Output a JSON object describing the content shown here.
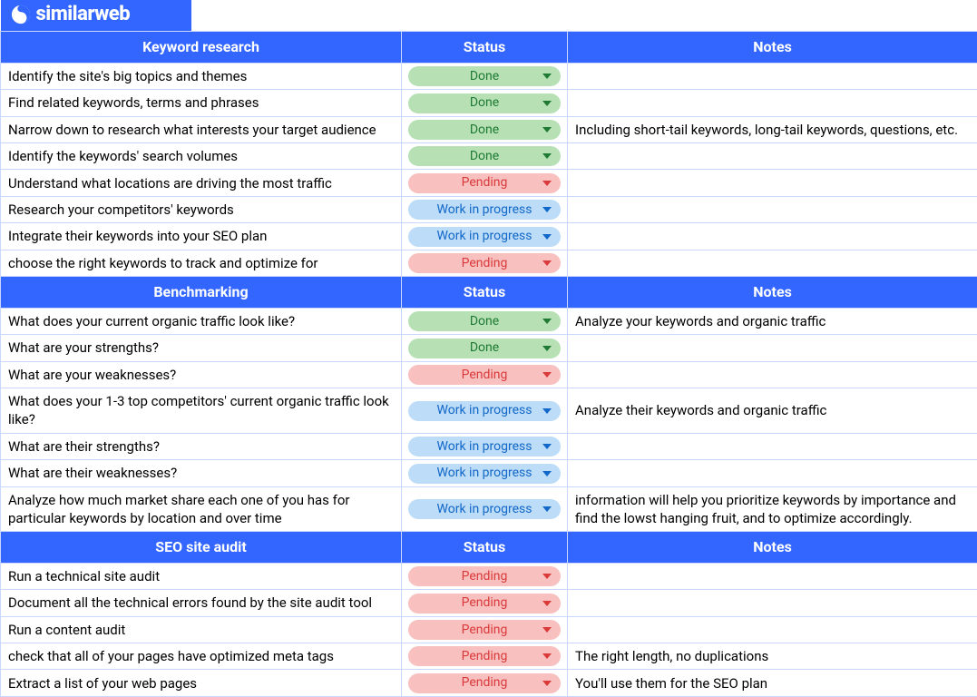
{
  "brand": "similarweb",
  "status_labels": {
    "done": "Done",
    "pending": "Pending",
    "wip": "Work in progress"
  },
  "sections": [
    {
      "title": "Keyword research",
      "status_header": "Status",
      "notes_header": "Notes",
      "rows": [
        {
          "task": "Identify the site's big topics and themes",
          "status": "done",
          "notes": ""
        },
        {
          "task": "Find related keywords, terms and phrases",
          "status": "done",
          "notes": ""
        },
        {
          "task": "Narrow down to research what interests your target audience",
          "status": "done",
          "notes": "Including short-tail keywords, long-tail keywords, questions, etc."
        },
        {
          "task": "Identify the keywords' search volumes",
          "status": "done",
          "notes": ""
        },
        {
          "task": "Understand what locations are driving the most traffic",
          "status": "pending",
          "notes": ""
        },
        {
          "task": "Research your competitors' keywords",
          "status": "wip",
          "notes": ""
        },
        {
          "task": "Integrate their keywords into your SEO plan",
          "status": "wip",
          "notes": ""
        },
        {
          "task": "choose the right keywords to track and optimize for",
          "status": "pending",
          "notes": ""
        }
      ]
    },
    {
      "title": "Benchmarking",
      "status_header": "Status",
      "notes_header": "Notes",
      "rows": [
        {
          "task": "What does your current organic traffic look like?",
          "status": "done",
          "notes": "Analyze your keywords and organic traffic"
        },
        {
          "task": "What are your strengths?",
          "status": "done",
          "notes": ""
        },
        {
          "task": "What are your weaknesses?",
          "status": "pending",
          "notes": ""
        },
        {
          "task": "What does your 1-3 top competitors' current organic traffic look like?",
          "status": "wip",
          "notes": "Analyze their keywords and organic traffic"
        },
        {
          "task": "What are their strengths?",
          "status": "wip",
          "notes": ""
        },
        {
          "task": "What are their weaknesses?",
          "status": "wip",
          "notes": ""
        },
        {
          "task": "Analyze how much market share each one of you has for particular keywords by location and over time",
          "status": "wip",
          "notes": "information will help you prioritize keywords by importance and find the lowst hanging fruit, and to optimize accordingly."
        }
      ]
    },
    {
      "title": "SEO site audit",
      "status_header": "Status",
      "notes_header": "Notes",
      "rows": [
        {
          "task": "Run a technical site audit",
          "status": "pending",
          "notes": ""
        },
        {
          "task": "Document all the technical errors found by the site audit tool",
          "status": "pending",
          "notes": ""
        },
        {
          "task": "Run a content audit",
          "status": "pending",
          "notes": ""
        },
        {
          "task": "check that all of your pages have optimized meta tags",
          "status": "pending",
          "notes": "The right length, no duplications"
        },
        {
          "task": "Extract a list of your web pages",
          "status": "pending",
          "notes": "You'll use them for the SEO plan"
        }
      ]
    }
  ]
}
